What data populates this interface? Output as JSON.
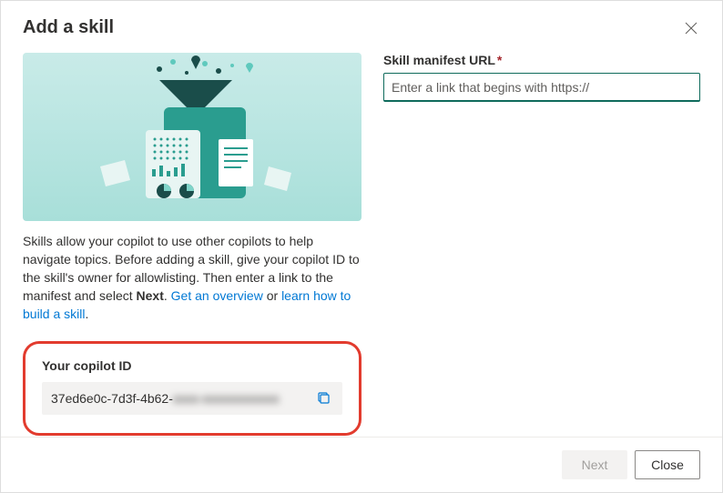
{
  "header": {
    "title": "Add a skill"
  },
  "description": {
    "text_before": "Skills allow your copilot to use other copilots to help navigate topics. Before adding a skill, give your copilot ID to the skill's owner for allowlisting. Then enter a link to the manifest and select ",
    "bold": "Next",
    "after_bold": ". ",
    "link1": "Get an overview",
    "between_links": " or ",
    "link2": "learn how to build a skill",
    "end": "."
  },
  "copilot": {
    "label": "Your copilot ID",
    "id_visible": "37ed6e0c-7d3f-4b62-",
    "id_redacted": "xxxx-xxxxxxxxxxxx"
  },
  "form": {
    "url_label": "Skill manifest URL",
    "url_placeholder": "Enter a link that begins with https://"
  },
  "footer": {
    "next": "Next",
    "close": "Close"
  }
}
